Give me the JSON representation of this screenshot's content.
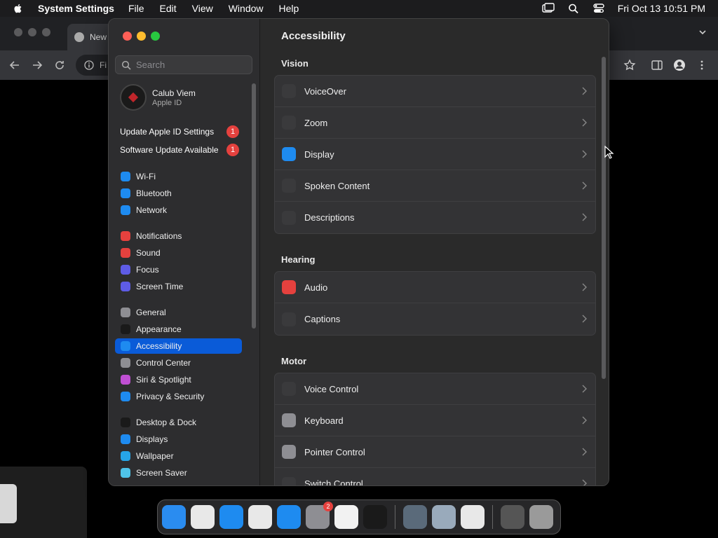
{
  "menubar": {
    "app_name": "System Settings",
    "items": [
      "File",
      "Edit",
      "View",
      "Window",
      "Help"
    ],
    "clock": "Fri Oct 13  10:51 PM"
  },
  "browser": {
    "tab_title": "New",
    "omnibox_text": "Fi"
  },
  "window": {
    "search_placeholder": "Search",
    "user": {
      "name": "Calub Viem",
      "subtitle": "Apple ID"
    },
    "notices": [
      {
        "label": "Update Apple ID Settings",
        "count": "1"
      },
      {
        "label": "Software Update Available",
        "count": "1"
      }
    ],
    "sidebar": [
      {
        "label": "Wi-Fi",
        "color": "#1e8bf0"
      },
      {
        "label": "Bluetooth",
        "color": "#1e8bf0"
      },
      {
        "label": "Network",
        "color": "#1e8bf0"
      },
      {
        "label": "Notifications",
        "color": "#e5413e"
      },
      {
        "label": "Sound",
        "color": "#e5413e"
      },
      {
        "label": "Focus",
        "color": "#5e5ce6"
      },
      {
        "label": "Screen Time",
        "color": "#5e5ce6"
      },
      {
        "label": "General",
        "color": "#8e8e93"
      },
      {
        "label": "Appearance",
        "color": "#1a1a1a"
      },
      {
        "label": "Accessibility",
        "color": "#1e8bf0"
      },
      {
        "label": "Control Center",
        "color": "#8e8e93"
      },
      {
        "label": "Siri & Spotlight",
        "color": "#c04fd3"
      },
      {
        "label": "Privacy & Security",
        "color": "#1e8bf0"
      },
      {
        "label": "Desktop & Dock",
        "color": "#1a1a1a"
      },
      {
        "label": "Displays",
        "color": "#1e8bf0"
      },
      {
        "label": "Wallpaper",
        "color": "#26a5e8"
      },
      {
        "label": "Screen Saver",
        "color": "#4fc3e8"
      }
    ],
    "selected_index": 9
  },
  "content": {
    "title": "Accessibility",
    "sections": [
      {
        "title": "Vision",
        "rows": [
          {
            "label": "VoiceOver",
            "icon": "voiceover-icon",
            "color": "#3a3a3c"
          },
          {
            "label": "Zoom",
            "icon": "zoom-icon",
            "color": "#3a3a3c"
          },
          {
            "label": "Display",
            "icon": "display-icon",
            "color": "#1e8bf0"
          },
          {
            "label": "Spoken Content",
            "icon": "spoken-content-icon",
            "color": "#3a3a3c"
          },
          {
            "label": "Descriptions",
            "icon": "descriptions-icon",
            "color": "#3a3a3c"
          }
        ]
      },
      {
        "title": "Hearing",
        "rows": [
          {
            "label": "Audio",
            "icon": "audio-icon",
            "color": "#e5413e"
          },
          {
            "label": "Captions",
            "icon": "captions-icon",
            "color": "#3a3a3c"
          }
        ]
      },
      {
        "title": "Motor",
        "rows": [
          {
            "label": "Voice Control",
            "icon": "voice-control-icon",
            "color": "#3a3a3c"
          },
          {
            "label": "Keyboard",
            "icon": "keyboard-icon",
            "color": "#8e8e93"
          },
          {
            "label": "Pointer Control",
            "icon": "pointer-control-icon",
            "color": "#8e8e93"
          },
          {
            "label": "Switch Control",
            "icon": "switch-control-icon",
            "color": "#3a3a3c"
          }
        ]
      }
    ]
  },
  "dock": {
    "apps": [
      {
        "name": "finder",
        "color": "#2a8cf0"
      },
      {
        "name": "launchpad",
        "color": "#e8e8e8"
      },
      {
        "name": "safari",
        "color": "#1e8bf0"
      },
      {
        "name": "chrome",
        "color": "#e8e8e8"
      },
      {
        "name": "app-store",
        "color": "#1e8bf0"
      },
      {
        "name": "system-settings",
        "color": "#8e8e93",
        "badge": "2"
      },
      {
        "name": "textedit",
        "color": "#f2f2f2"
      },
      {
        "name": "terminal",
        "color": "#1a1a1a"
      },
      {
        "name": "quicktime",
        "color": "#5a6a7a"
      },
      {
        "name": "preview",
        "color": "#9ab"
      },
      {
        "name": "parallels",
        "color": "#e8e8e8"
      },
      {
        "name": "downloads-stack",
        "color": "#555"
      },
      {
        "name": "trash",
        "color": "#9a9a9a"
      }
    ]
  }
}
